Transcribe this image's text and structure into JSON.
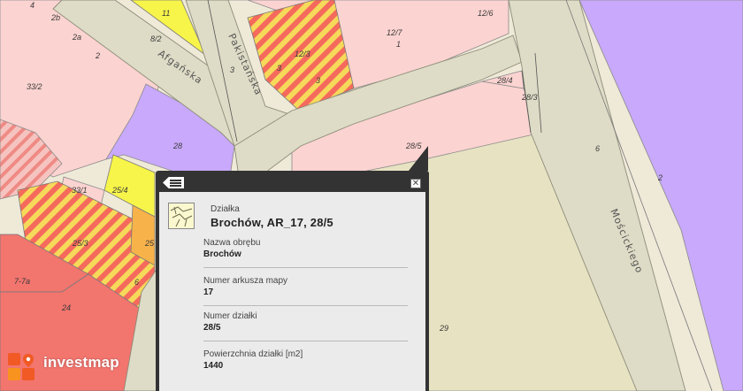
{
  "map": {
    "street_labels": {
      "afganska": "Afgańska",
      "pakistanska": "Pakistańska",
      "moscickiego": "Mościckiego"
    },
    "parcel_labels": {
      "p4": "4",
      "p2b": "2b",
      "p2a": "2a",
      "p2": "2",
      "p33_2": "33/2",
      "p11": "11",
      "p8_2": "8/2",
      "p3a": "3",
      "p12_3": "12/3",
      "p3b": "3",
      "p3c": "3",
      "p12_6": "12/6",
      "p12_7": "12/7",
      "p1": "1",
      "p28_4": "28/4",
      "p28_3": "28/3",
      "p28": "28",
      "p28_5": "28/5",
      "p6": "6",
      "p2r": "2",
      "p33_1": "33/1",
      "p25_4": "25/4",
      "p25_3": "25/3",
      "p25": "25",
      "p6b": "6",
      "p7_7a": "7-7a",
      "p24": "24",
      "p29": "29"
    },
    "colors": {
      "background": "#efe9d8",
      "road": "#dedcc6",
      "road_edge": "#8c8c7a",
      "residential": "#fbd3d0",
      "agricultural": "#c8a9fb",
      "yellow": "#f7f44a",
      "red": "#f2756e",
      "orange": "#f7b24a",
      "olive": "#e7e3c2",
      "stripe_red": "#f56a5c",
      "stripe_yellow": "#f6d95a"
    }
  },
  "popup": {
    "layer_type": "Działka",
    "title": "Brochów, AR_17, 28/5",
    "fields": [
      {
        "label": "Nazwa obrębu",
        "value": "Brochów"
      },
      {
        "label": "Numer arkusza mapy",
        "value": "17"
      },
      {
        "label": "Numer działki",
        "value": "28/5"
      },
      {
        "label": "Powierzchnia działki [m2]",
        "value": "1440"
      }
    ],
    "menu_icon": "list-menu-icon",
    "close_icon": "close-icon"
  },
  "logo": {
    "text": "investmap",
    "icon": "location-pin-icon"
  }
}
